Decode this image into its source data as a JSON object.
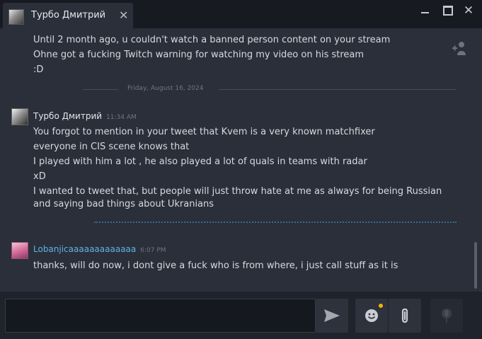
{
  "window": {
    "tab_title": "Турбо Дмитрий",
    "close_tab_glyph": "✕",
    "close_glyph": "✕"
  },
  "messages": {
    "prev_lines": [
      "Until 2 month ago, u couldn't watch a banned person content on your stream",
      "Ohne got a fucking Twitch warning for watching my video on his stream",
      ":D"
    ],
    "date_divider": "Friday, August 16, 2024",
    "group1": {
      "name": "Турбо Дмитрий",
      "time": "11:34 AM",
      "lines": [
        "You forgot to mention in your tweet that Kvem is a very known matchfixer",
        "everyone in CIS scene knows that",
        "I played with him a lot , he also played a lot of quals in teams with radar",
        "xD",
        "I wanted to tweet that, but people will just throw hate at me as always for being Russian",
        "and saying bad things about Ukranians"
      ]
    },
    "group2": {
      "name": "Lobanjicaaaaaaaaaaaaa",
      "time": "6:07 PM",
      "lines": [
        "thanks, will do now, i dont give a fuck who is from where, i just call stuff as it is"
      ]
    }
  },
  "composer": {
    "input_value": "",
    "icons": [
      "send-icon",
      "emoji-icon",
      "paperclip-icon",
      "microphone-icon",
      "add-friend-icon"
    ]
  },
  "colors": {
    "accent_blue": "#63b2e4",
    "notification_dot": "#f1b20a",
    "chat_bg": "#2a2f3a"
  }
}
